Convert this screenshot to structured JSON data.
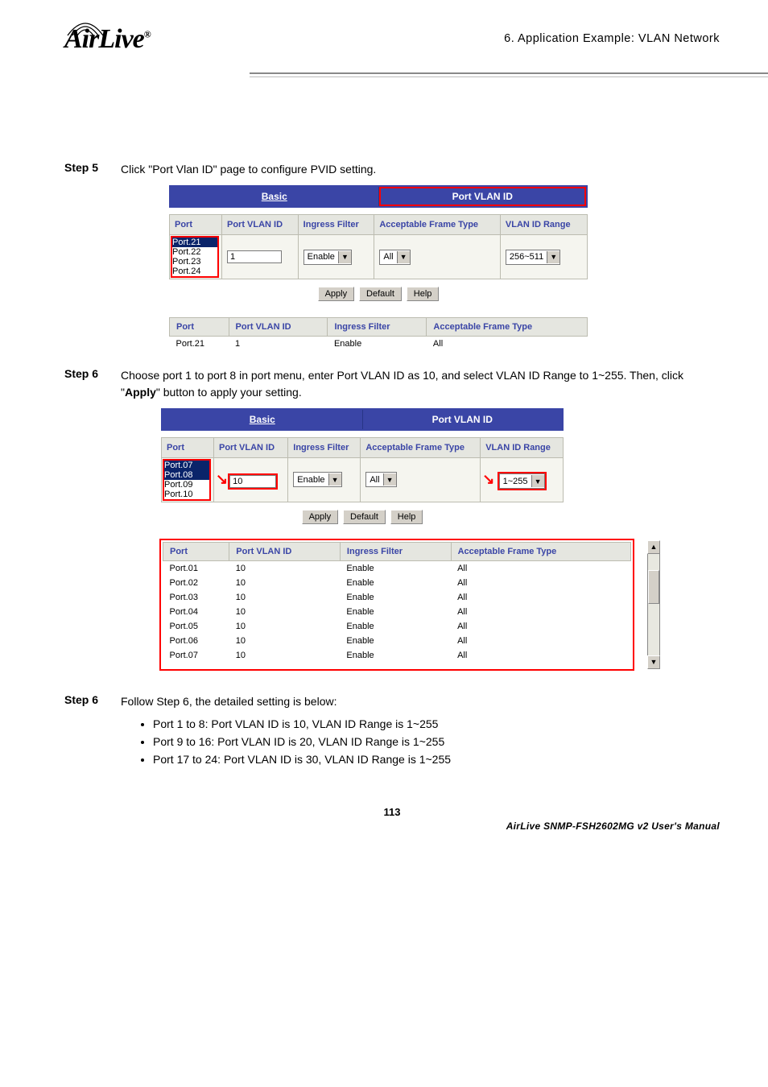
{
  "header": {
    "chapter": "6.  Application Example: VLAN Network",
    "logo_text": "AirLive",
    "logo_reg": "®"
  },
  "step5": {
    "label": "Step 5",
    "text": "Click \"Port Vlan ID\" page to configure PVID setting.",
    "tabs": {
      "basic": "Basic",
      "pvid": "Port VLAN ID"
    },
    "th": {
      "port": "Port",
      "pvid": "Port VLAN ID",
      "ingress": "Ingress Filter",
      "aft": "Acceptable Frame Type",
      "range": "VLAN ID Range"
    },
    "ports": [
      "Port.21",
      "Port.22",
      "Port.23",
      "Port.24"
    ],
    "pvid_val": "1",
    "ingress_val": "Enable",
    "aft_val": "All",
    "range_val": "256~511",
    "btns": {
      "apply": "Apply",
      "default": "Default",
      "help": "Help"
    },
    "stat": {
      "th_port": "Port",
      "th_pvid": "Port VLAN ID",
      "th_ing": "Ingress Filter",
      "th_aft": "Acceptable Frame Type",
      "row": {
        "port": "Port.21",
        "pvid": "1",
        "ing": "Enable",
        "aft": "All"
      }
    }
  },
  "step6a": {
    "label": "Step 6",
    "text_pre": "Choose port 1 to port 8 in port menu, enter Port VLAN ID as 10, and select VLAN ID Range to 1~255. Then, click \"",
    "text_bold": "Apply",
    "text_post": "\" button to apply your setting.",
    "tabs": {
      "basic": "Basic",
      "pvid": "Port VLAN ID"
    },
    "th": {
      "port": "Port",
      "pvid": "Port VLAN ID",
      "ingress": "Ingress Filter",
      "aft": "Acceptable Frame Type",
      "range": "VLAN ID Range"
    },
    "ports": [
      "Port.07",
      "Port.08",
      "Port.09",
      "Port.10"
    ],
    "pvid_val": "10",
    "ingress_val": "Enable",
    "aft_val": "All",
    "range_val": "1~255",
    "btns": {
      "apply": "Apply",
      "default": "Default",
      "help": "Help"
    },
    "stat_th": {
      "port": "Port",
      "pvid": "Port VLAN ID",
      "ing": "Ingress Filter",
      "aft": "Acceptable Frame Type"
    },
    "stat_rows": [
      {
        "port": "Port.01",
        "pvid": "10",
        "ing": "Enable",
        "aft": "All"
      },
      {
        "port": "Port.02",
        "pvid": "10",
        "ing": "Enable",
        "aft": "All"
      },
      {
        "port": "Port.03",
        "pvid": "10",
        "ing": "Enable",
        "aft": "All"
      },
      {
        "port": "Port.04",
        "pvid": "10",
        "ing": "Enable",
        "aft": "All"
      },
      {
        "port": "Port.05",
        "pvid": "10",
        "ing": "Enable",
        "aft": "All"
      },
      {
        "port": "Port.06",
        "pvid": "10",
        "ing": "Enable",
        "aft": "All"
      },
      {
        "port": "Port.07",
        "pvid": "10",
        "ing": "Enable",
        "aft": "All"
      }
    ]
  },
  "step6b": {
    "label": "Step 6",
    "text": "Follow Step 6, the detailed setting is below:",
    "bullets": [
      "Port 1 to 8: Port VLAN ID is 10, VLAN ID Range is 1~255",
      "Port 9 to 16: Port VLAN ID is 20, VLAN ID Range is 1~255",
      "Port 17 to 24: Port VLAN ID is 30, VLAN ID Range is 1~255"
    ]
  },
  "footer": {
    "page": "113",
    "manual": "AirLive SNMP-FSH2602MG v2 User's Manual"
  }
}
